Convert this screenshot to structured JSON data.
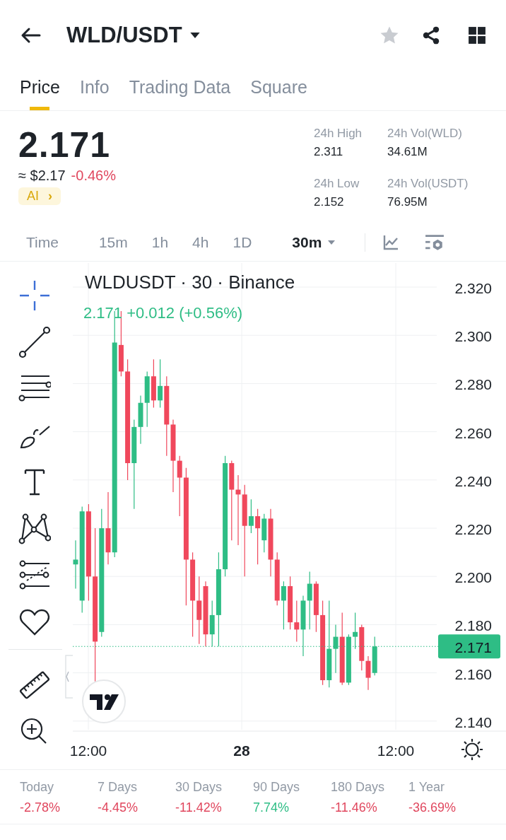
{
  "header": {
    "pair": "WLD/USDT",
    "favorite": false
  },
  "tabs": [
    {
      "label": "Price",
      "selected": true
    },
    {
      "label": "Info",
      "selected": false
    },
    {
      "label": "Trading Data",
      "selected": false
    },
    {
      "label": "Square",
      "selected": false
    }
  ],
  "summary": {
    "price": "2.171",
    "fiat": "≈ $2.17",
    "change": "-0.46%",
    "ai_badge": "AI",
    "ai_arrow": "›"
  },
  "stats": [
    {
      "label": "24h High",
      "value": "2.311"
    },
    {
      "label": "24h Vol(WLD)",
      "value": "34.61M"
    },
    {
      "label": "24h Low",
      "value": "2.152"
    },
    {
      "label": "24h Vol(USDT)",
      "value": "76.95M"
    }
  ],
  "intervals": [
    {
      "label": "Time",
      "selected": false
    },
    {
      "label": "15m",
      "selected": false
    },
    {
      "label": "1h",
      "selected": false
    },
    {
      "label": "4h",
      "selected": false
    },
    {
      "label": "1D",
      "selected": false
    },
    {
      "label": "30m",
      "selected": true
    }
  ],
  "chart": {
    "title": "WLDUSDT · 30 · Binance",
    "last": "2.171",
    "change": "+0.012 (+0.56%)",
    "price_labels": [
      "2.320",
      "2.300",
      "2.280",
      "2.260",
      "2.240",
      "2.220",
      "2.200",
      "2.180",
      "2.160",
      "2.140"
    ],
    "current_price": "2.171",
    "time_labels": [
      {
        "label": "12:00",
        "bold": false
      },
      {
        "label": "28",
        "bold": true
      },
      {
        "label": "12:00",
        "bold": false
      }
    ]
  },
  "periods": [
    {
      "label": "Today",
      "value": "-2.78%",
      "color": "#e0475e"
    },
    {
      "label": "7 Days",
      "value": "-4.45%",
      "color": "#e0475e"
    },
    {
      "label": "30 Days",
      "value": "-11.42%",
      "color": "#e0475e"
    },
    {
      "label": "90 Days",
      "value": "7.74%",
      "color": "#2ebd85"
    },
    {
      "label": "180 Days",
      "value": "-11.46%",
      "color": "#e0475e"
    },
    {
      "label": "1 Year",
      "value": "-36.69%",
      "color": "#e0475e"
    }
  ]
}
